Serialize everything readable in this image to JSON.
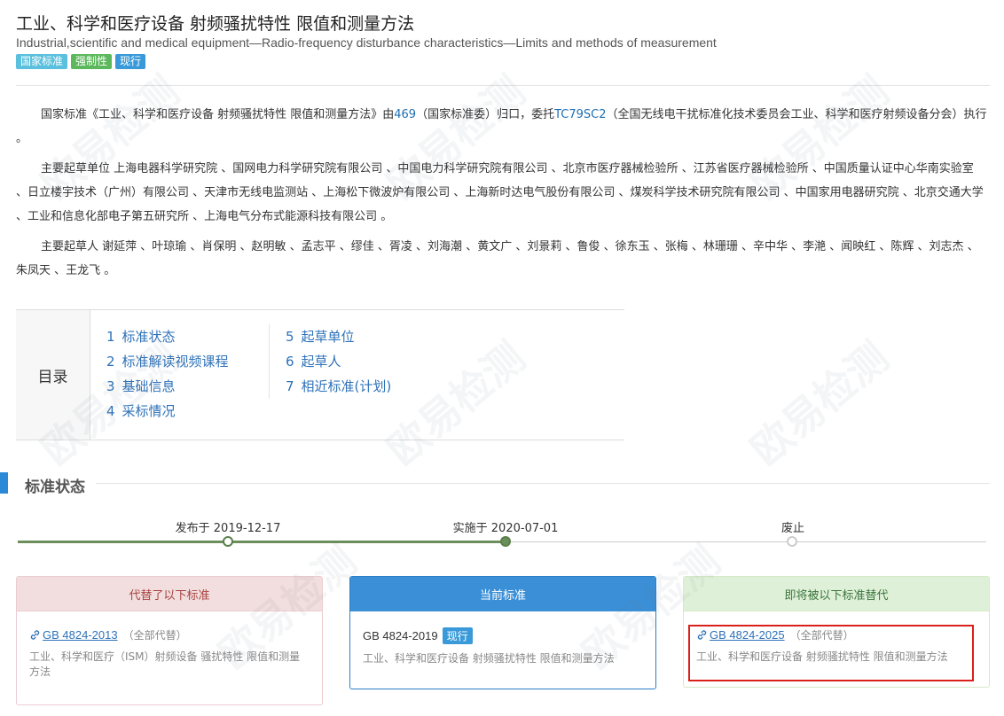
{
  "header": {
    "title": "工业、科学和医疗设备 射频骚扰特性 限值和测量方法",
    "subtitle": "Industrial,scientific and medical equipment—Radio-frequency disturbance characteristics—Limits and methods of measurement",
    "badges": [
      "国家标准",
      "强制性",
      "现行"
    ]
  },
  "intro": {
    "p1_a": "国家标准《工业、科学和医疗设备 射频骚扰特性 限值和测量方法》由",
    "p1_link1": "469",
    "p1_b": "（国家标准委）归口，委托",
    "p1_link2": "TC79SC2",
    "p1_c": "（全国无线电干扰标准化技术委员会工业、科学和医疗射频设备分会）执行 。",
    "p2": "主要起草单位 上海电器科学研究院 、国网电力科学研究院有限公司 、中国电力科学研究院有限公司 、北京市医疗器械检验所 、江苏省医疗器械检验所 、中国质量认证中心华南实验室 、日立楼宇技术（广州）有限公司 、天津市无线电监测站 、上海松下微波炉有限公司 、上海新时达电气股份有限公司 、煤炭科学技术研究院有限公司 、中国家用电器研究院 、北京交通大学 、工业和信息化部电子第五研究所 、上海电气分布式能源科技有限公司 。",
    "p3": "主要起草人 谢延萍 、叶琼瑜 、肖保明 、赵明敏 、孟志平 、缪佳 、胥凌 、刘海潮 、黄文广 、刘景莉 、鲁俊 、徐东玉 、张梅 、林珊珊 、辛中华 、李滟 、闻映红 、陈辉 、刘志杰 、朱凤天 、王龙飞 。"
  },
  "toc": {
    "label": "目录",
    "col1": [
      {
        "num": "1",
        "label": "标准状态"
      },
      {
        "num": "2",
        "label": "标准解读视频课程"
      },
      {
        "num": "3",
        "label": "基础信息"
      },
      {
        "num": "4",
        "label": "采标情况"
      }
    ],
    "col2": [
      {
        "num": "5",
        "label": "起草单位"
      },
      {
        "num": "6",
        "label": "起草人"
      },
      {
        "num": "7",
        "label": "相近标准(计划)"
      }
    ]
  },
  "status_section": {
    "title": "标准状态",
    "timeline": [
      {
        "label": "发布于 2019-12-17",
        "state": "done"
      },
      {
        "label": "实施于 2020-07-01",
        "state": "current"
      },
      {
        "label": "废止",
        "state": "pending"
      }
    ],
    "cards": {
      "replaced": {
        "header": "代替了以下标准",
        "code": "GB 4824-2013",
        "note": "（全部代替）",
        "desc": "工业、科学和医疗（ISM）射频设备 骚扰特性 限值和测量方法"
      },
      "current": {
        "header": "当前标准",
        "code": "GB 4824-2019",
        "badge": "现行",
        "desc": "工业、科学和医疗设备 射频骚扰特性 限值和测量方法"
      },
      "upcoming": {
        "header": "即将被以下标准替代",
        "code": "GB 4824-2025",
        "note": "（全部代替）",
        "desc": "工业、科学和医疗设备 射频骚扰特性 限值和测量方法"
      }
    }
  },
  "watermark": "欧易检测",
  "colors": {
    "link": "#2e72b8",
    "accent": "#3a8fd6",
    "timeline_done": "#6b8e5a",
    "highlight_box": "#d9201a"
  }
}
